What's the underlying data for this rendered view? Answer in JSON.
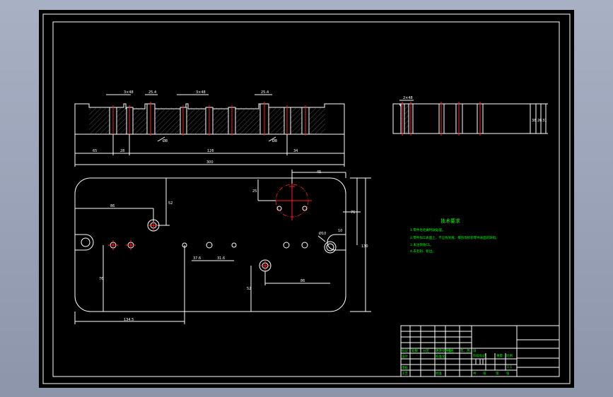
{
  "drawing": {
    "top_view_dims": {
      "slot_width_a": "3×48",
      "slot_width_b": "25.4",
      "slot_width_c": "3×48",
      "slot_width_d": "25.4",
      "hole_a": "Ø8",
      "hole_b": "Ø8",
      "pos_1": "65",
      "pos_2": "28",
      "pos_3": "126",
      "pos_4": "34",
      "overall": "300"
    },
    "side_view_dims": {
      "top": "2×48",
      "h1": "38",
      "h2": "26",
      "h3": "31"
    },
    "plan_dims": {
      "d_top": "45",
      "d_r1": "25",
      "d_r2": "76",
      "d_overall_h": "130",
      "d_left1": "86",
      "d_left2": "52",
      "d_mid1": "37.6",
      "d_mid2": "31.6",
      "d_circle": "Ø10",
      "d_right": "10",
      "d_lower": "76",
      "d_lower2": "52",
      "d_bottom": "134.5",
      "d_right2": "86"
    },
    "notes": {
      "title": "技术要求",
      "line1": "1.零件毛坯做时效处理。",
      "line2": "2.零件加工表面上，不应有划痕、擦伤等损伤零件表面的缺陷。",
      "line3": "3.未注倒角C1。",
      "line4": "4.去毛刺、锐边。"
    },
    "title_block": {
      "row_labels": [
        "标记",
        "处数",
        "分区",
        "更改文件号",
        "签名",
        "年、月、日"
      ],
      "design": "设计",
      "check": "审核",
      "process": "工艺",
      "standard": "标准化",
      "approve": "批准",
      "stage": "阶段标记",
      "weight": "重量",
      "scale": "比例",
      "scale_value": "1:1",
      "sheets": "共",
      "sheet": "张",
      "page": "第",
      "page_unit": "张"
    }
  }
}
